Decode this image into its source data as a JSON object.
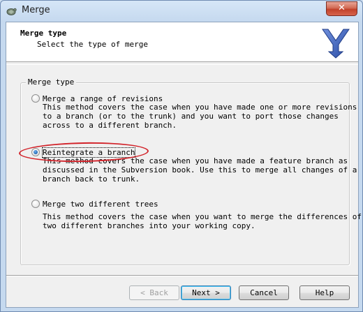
{
  "window": {
    "title": "Merge",
    "close_glyph": "✕"
  },
  "header": {
    "title": "Merge type",
    "subtitle": "Select the type of merge"
  },
  "group": {
    "label": "Merge type"
  },
  "options": [
    {
      "label": "Merge a range of revisions",
      "checked": false,
      "description": "This method covers the case when you have made one or more revisions\nto a branch (or to the trunk) and you want to port those changes\nacross to a different branch."
    },
    {
      "label": "Reintegrate a branch",
      "checked": true,
      "description": "This method covers the case when you have made a feature branch as\ndiscussed in the Subversion book. Use this to merge all changes of a\nbranch back to trunk."
    },
    {
      "label": "Merge two different trees",
      "checked": false,
      "description": "This method covers the case when you want to merge the differences of\ntwo different branches into your working copy."
    }
  ],
  "buttons": {
    "back": "< Back",
    "next": "Next >",
    "cancel": "Cancel",
    "help": "Help"
  },
  "icons": {
    "app": "tortoise-icon",
    "header": "merge-arrows-icon"
  },
  "colors": {
    "annotation": "#d2232a",
    "merge_icon": "#3a5fb8"
  }
}
